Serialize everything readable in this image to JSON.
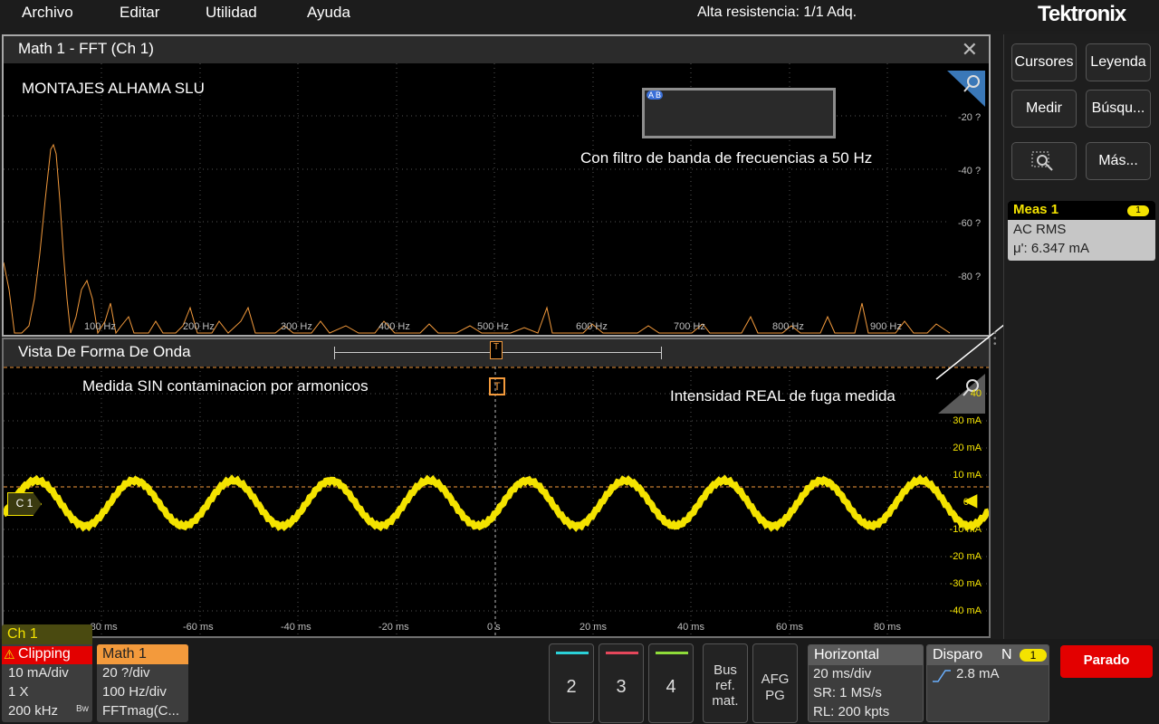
{
  "menu": [
    "Archivo",
    "Editar",
    "Utilidad",
    "Ayuda"
  ],
  "status": "Alta resistencia: 1/1 Adq.",
  "logo": "Tektronix",
  "fft": {
    "title": "Math 1 - FFT (Ch 1)",
    "note1": "MONTAJES ALHAMA SLU",
    "note2": "Con filtro de banda de frecuencias a 50 Hz",
    "freq_labels": [
      "100 Hz",
      "200 Hz",
      "300 Hz",
      "400 Hz",
      "500 Hz",
      "600 Hz",
      "700 Hz",
      "800 Hz",
      "900 Hz"
    ],
    "y_labels": [
      "-20 ?",
      "-40 ?",
      "-60 ?",
      "-80 ?"
    ],
    "ab_icon": "A B",
    "color": "#f39a3c"
  },
  "wave": {
    "title": "Vista De Forma De Onda",
    "note1": "Medida SIN contaminacion por armonicos",
    "note2": "Intensidad REAL de fuga medida",
    "y_labels": [
      "40",
      "30 mA",
      "20 mA",
      "10 mA",
      "0",
      "-10 mA",
      "-20 mA",
      "-30 mA",
      "-40 mA"
    ],
    "x_labels": [
      "-80 ms",
      "-60 ms",
      "-40 ms",
      "-20 ms",
      "0 s",
      "20 ms",
      "40 ms",
      "60 ms",
      "80 ms"
    ],
    "ch_marker": "C 1",
    "trigger_marker": "T",
    "color": "#f4e300"
  },
  "right": {
    "buttons": [
      "Cursores",
      "Leyenda",
      "Medir",
      "Búsqu...",
      "Más..."
    ],
    "meas": {
      "title": "Meas 1",
      "badge": "1",
      "type": "AC RMS",
      "value": "μ': 6.347 mA"
    }
  },
  "bottom": {
    "ch1": {
      "title": "Ch 1",
      "warn": "Clipping",
      "l1": "10 mA/div",
      "l2": "1 X",
      "l3": "200 kHz",
      "bw": "Bw"
    },
    "math1": {
      "title": "Math 1",
      "l1": "20 ?/div",
      "l2": "100 Hz/div",
      "l3": "FFTmag(C..."
    },
    "channels": [
      {
        "label": "2",
        "color": "#2bd1d8"
      },
      {
        "label": "3",
        "color": "#e5475b"
      },
      {
        "label": "4",
        "color": "#8fdc3a"
      }
    ],
    "bus": "Bus ref. mat.",
    "bus_lines": [
      "Bus",
      "ref.",
      "mat."
    ],
    "afg": [
      "AFG",
      "PG"
    ],
    "horizontal": {
      "title": "Horizontal",
      "l1": "20 ms/div",
      "l2": "SR: 1 MS/s",
      "l3": "RL: 200 kpts"
    },
    "trigger": {
      "title": "Disparo",
      "mode": "N",
      "badge": "1",
      "level": "2.8 mA"
    },
    "run": "Parado"
  }
}
